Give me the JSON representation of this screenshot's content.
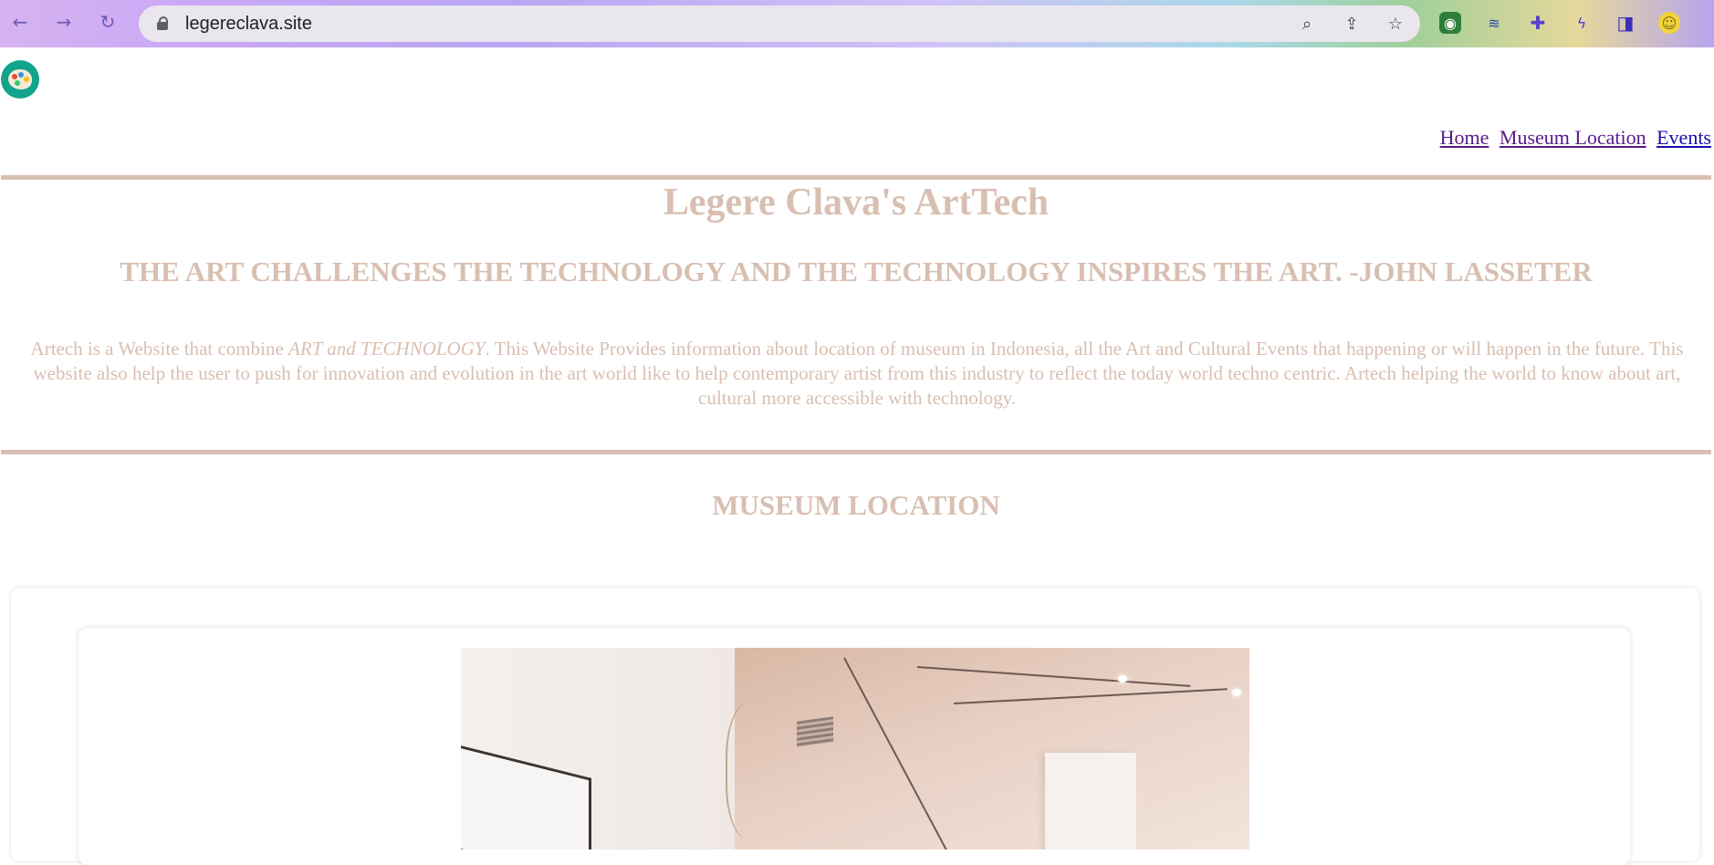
{
  "browser": {
    "url": "legereclava.site",
    "icons": {
      "back": "back-arrow-icon",
      "forward": "forward-arrow-icon",
      "reload": "reload-icon",
      "zoom": "zoom-icon",
      "share": "share-icon",
      "bookmark": "star-icon",
      "extensions": [
        "globe-extension-icon",
        "layers-extension-icon",
        "puzzle-extension-icon",
        "bolt-extension-icon",
        "sidepanel-icon",
        "profile-avatar"
      ]
    }
  },
  "site": {
    "logo_icon": "palette-icon",
    "nav": [
      {
        "label": "Home",
        "visited": true
      },
      {
        "label": "Museum Location",
        "visited": true
      },
      {
        "label": "Events",
        "visited": false
      }
    ],
    "title": "Legere Clava's ArtTech",
    "quote": "THE ART CHALLENGES THE TECHNOLOGY AND THE TECHNOLOGY INSPIRES THE ART. -JOHN LASSETER",
    "intro": {
      "before_em": "Artech is a Website that combine ",
      "em": "ART and TECHNOLOGY",
      "after_em": ". This Website Provides information about location of museum in Indonesia, all the Art and Cultural Events that happening or will happen in the future. This website also help the user to push for innovation and evolution in the art world like to help contemporary artist from this industry to reflect the today world techno centric. Artech helping the world to know about art, cultural more accessible with technology."
    },
    "section_title": "MUSEUM LOCATION"
  },
  "colors": {
    "accent": "#d8bfb1",
    "link": "#1a0dab",
    "visited_link": "#551a8b"
  }
}
